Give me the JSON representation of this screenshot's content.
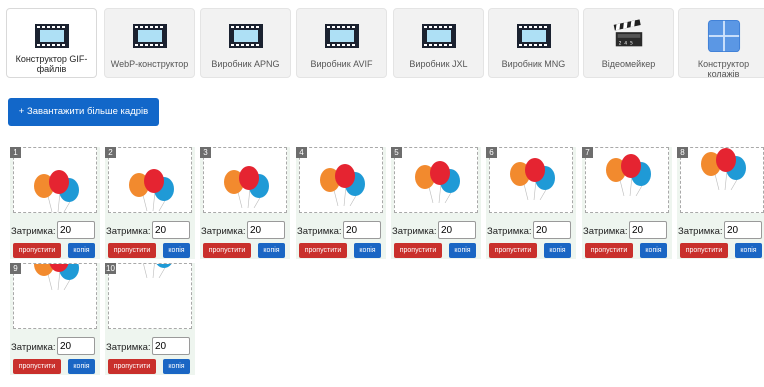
{
  "tabs": [
    {
      "label": "Конструктор GIF-файлів",
      "icon": "film-strip-icon",
      "active": true
    },
    {
      "label": "WebP-конструктор",
      "icon": "film-strip-icon"
    },
    {
      "label": "Виробник APNG",
      "icon": "film-strip-icon"
    },
    {
      "label": "Виробник AVIF",
      "icon": "film-strip-icon"
    },
    {
      "label": "Виробник JXL",
      "icon": "film-strip-icon"
    },
    {
      "label": "Виробник MNG",
      "icon": "film-strip-icon"
    },
    {
      "label": "Відеомейкер",
      "icon": "clapperboard-icon"
    },
    {
      "label": "Конструктор колажів",
      "icon": "collage-grid-icon"
    }
  ],
  "upload_button": "+ Завантажити більше кадрів",
  "frames": [
    {
      "number": "1",
      "delay_label": "Затримка:",
      "delay": "20",
      "skip": "пропустити",
      "copy": "копія"
    },
    {
      "number": "2",
      "delay_label": "Затримка:",
      "delay": "20",
      "skip": "пропустити",
      "copy": "копія"
    },
    {
      "number": "3",
      "delay_label": "Затримка:",
      "delay": "20",
      "skip": "пропустити",
      "copy": "копія"
    },
    {
      "number": "4",
      "delay_label": "Затримка:",
      "delay": "20",
      "skip": "пропустити",
      "copy": "копія"
    },
    {
      "number": "5",
      "delay_label": "Затримка:",
      "delay": "20",
      "skip": "пропустити",
      "copy": "копія"
    },
    {
      "number": "6",
      "delay_label": "Затримка:",
      "delay": "20",
      "skip": "пропустити",
      "copy": "копія"
    },
    {
      "number": "7",
      "delay_label": "Затримка:",
      "delay": "20",
      "skip": "пропустити",
      "copy": "копія"
    },
    {
      "number": "8",
      "delay_label": "Затримка:",
      "delay": "20",
      "skip": "пропустити",
      "copy": "копія"
    },
    {
      "number": "9",
      "delay_label": "Затримка:",
      "delay": "20",
      "skip": "пропустити",
      "copy": "копія"
    },
    {
      "number": "10",
      "delay_label": "Затримка:",
      "delay": "20",
      "skip": "пропустити",
      "copy": "копія"
    }
  ],
  "colors": {
    "upload": "#1267c9",
    "skip": "#c9302c",
    "copy": "#1a66c4",
    "balloon_orange": "#f28a2e",
    "balloon_red": "#e52431",
    "balloon_blue": "#1f9ad6"
  }
}
